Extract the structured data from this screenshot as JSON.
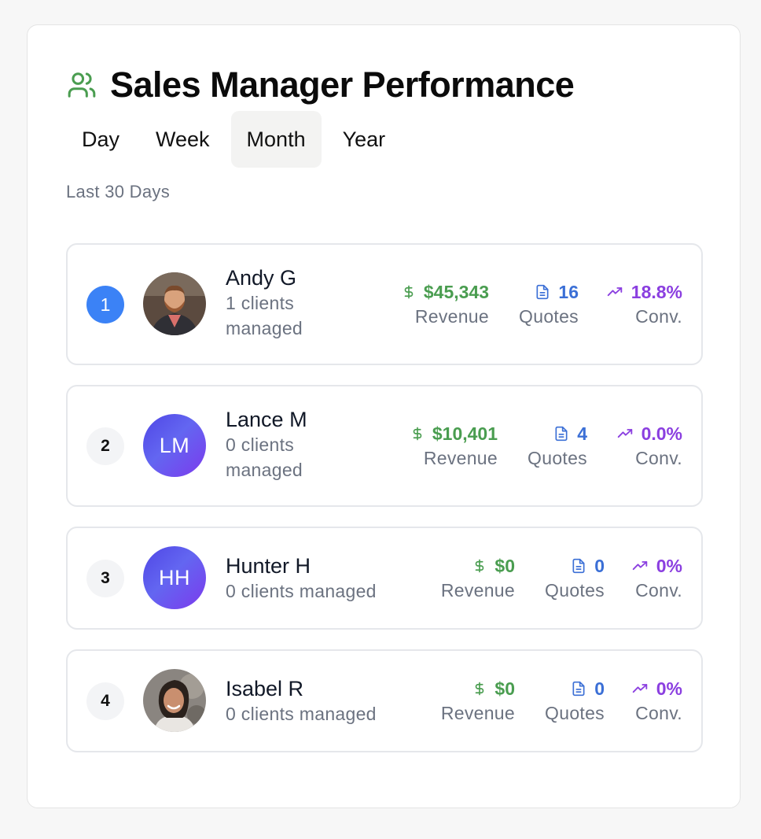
{
  "header": {
    "title": "Sales Manager Performance",
    "icon": "users-icon",
    "icon_color": "#4a9d50"
  },
  "tabs": [
    {
      "label": "Day",
      "active": false
    },
    {
      "label": "Week",
      "active": false
    },
    {
      "label": "Month",
      "active": true
    },
    {
      "label": "Year",
      "active": false
    }
  ],
  "period_label": "Last 30 Days",
  "managers": [
    {
      "rank": "1",
      "name": "Andy G",
      "clients": "1 clients managed",
      "avatar": "photo",
      "revenue": "$45,343",
      "revenue_label": "Revenue",
      "quotes": "16",
      "quotes_label": "Quotes",
      "conv": "18.8%",
      "conv_label": "Conv."
    },
    {
      "rank": "2",
      "name": "Lance M",
      "clients": "0 clients managed",
      "avatar": "LM",
      "revenue": "$10,401",
      "revenue_label": "Revenue",
      "quotes": "4",
      "quotes_label": "Quotes",
      "conv": "0.0%",
      "conv_label": "Conv."
    },
    {
      "rank": "3",
      "name": "Hunter H",
      "clients": "0 clients managed",
      "avatar": "HH",
      "revenue": "$0",
      "revenue_label": "Revenue",
      "quotes": "0",
      "quotes_label": "Quotes",
      "conv": "0%",
      "conv_label": "Conv."
    },
    {
      "rank": "4",
      "name": "Isabel R",
      "clients": "0 clients managed",
      "avatar": "photo",
      "revenue": "$0",
      "revenue_label": "Revenue",
      "quotes": "0",
      "quotes_label": "Quotes",
      "conv": "0%",
      "conv_label": "Conv."
    }
  ],
  "colors": {
    "revenue": "#4a9d50",
    "quotes": "#3b6fd6",
    "conv": "#8b3fe0",
    "rank_first": "#3b82f6"
  }
}
